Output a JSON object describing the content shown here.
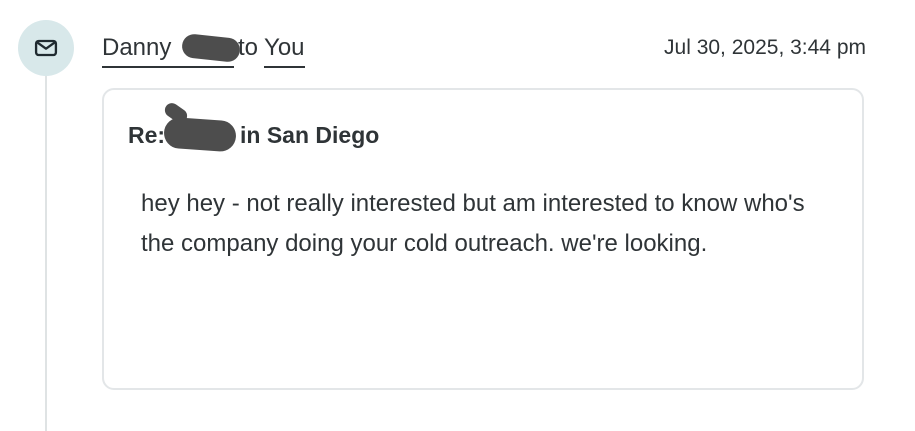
{
  "event": {
    "icon": "mail-icon",
    "sender": "Danny",
    "to_word": "to",
    "recipient": "You",
    "timestamp": "Jul 30, 2025, 3:44 pm"
  },
  "message": {
    "subject_prefix": "Re:",
    "subject_suffix": "in San Diego",
    "body": "hey hey - not really interested but am interested to know who's the company doing your cold outreach. we're looking."
  },
  "colors": {
    "icon_background": "#d8e8ea",
    "text": "#2f3437",
    "card_border": "#e3e6e8",
    "redaction": "#4d4d4d",
    "timeline": "#dfe3e4"
  }
}
